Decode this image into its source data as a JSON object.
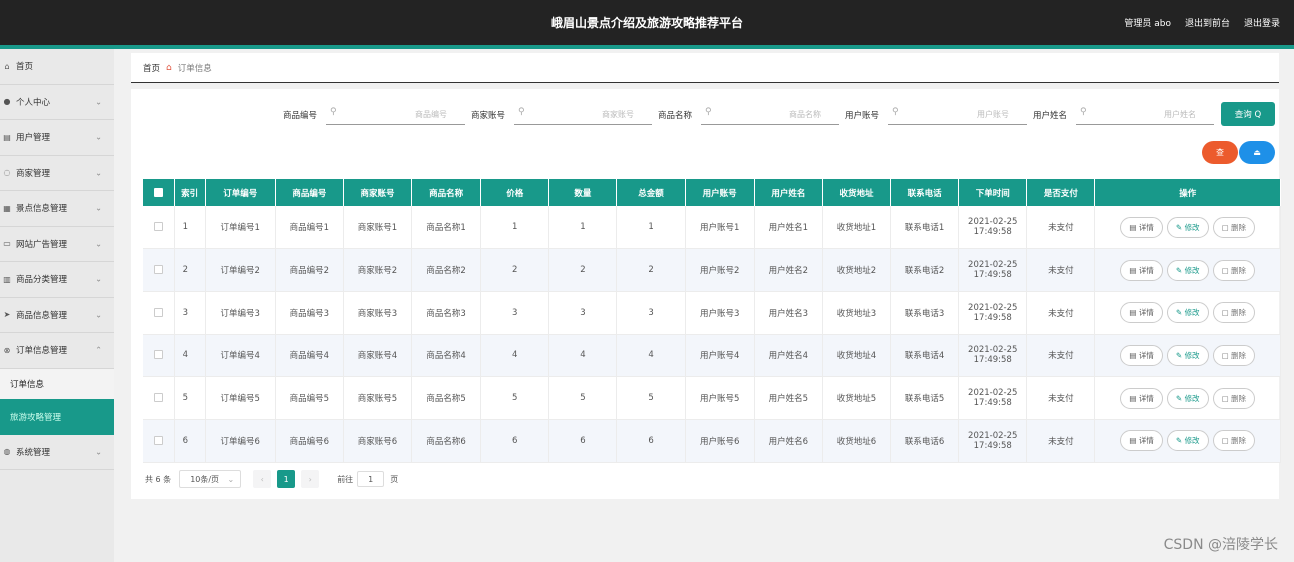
{
  "header": {
    "title": "峨眉山景点介绍及旅游攻略推荐平台",
    "admin_label": "管理员 abo",
    "exit_to_front": "退出到前台",
    "logout": "退出登录"
  },
  "sidebar": {
    "items": [
      {
        "label": "首页",
        "icon": "home-icon"
      },
      {
        "label": "个人中心",
        "icon": "user-icon"
      },
      {
        "label": "用户管理",
        "icon": "users-icon"
      },
      {
        "label": "商家管理",
        "icon": "store-icon"
      },
      {
        "label": "景点信息管理",
        "icon": "grid-icon"
      },
      {
        "label": "网站广告管理",
        "icon": "ad-icon"
      },
      {
        "label": "商品分类管理",
        "icon": "chart-icon"
      },
      {
        "label": "商品信息管理",
        "icon": "send-icon"
      },
      {
        "label": "订单信息管理",
        "icon": "order-icon"
      },
      {
        "label": "系统管理",
        "icon": "settings-icon"
      }
    ],
    "sub_order": "订单信息",
    "sub_active": "旅游攻略管理"
  },
  "breadcrumb": {
    "home": "首页",
    "current": "订单信息"
  },
  "search": {
    "fields": [
      {
        "label": "商品编号",
        "placeholder": "商品编号"
      },
      {
        "label": "商家账号",
        "placeholder": "商家账号"
      },
      {
        "label": "商品名称",
        "placeholder": "商品名称"
      },
      {
        "label": "用户账号",
        "placeholder": "用户账号"
      },
      {
        "label": "用户姓名",
        "placeholder": "用户姓名"
      }
    ],
    "button": "查询 Q"
  },
  "action_buttons": {
    "red": "查",
    "blue": "⏏"
  },
  "table": {
    "headers": [
      "",
      "索引",
      "订单编号",
      "商品编号",
      "商家账号",
      "商品名称",
      "价格",
      "数量",
      "总金额",
      "用户账号",
      "用户姓名",
      "收货地址",
      "联系电话",
      "下单时间",
      "是否支付",
      "操作"
    ],
    "ops": {
      "detail": "详情",
      "edit": "修改",
      "delete": "删除"
    },
    "rows": [
      [
        "1",
        "订单编号1",
        "商品编号1",
        "商家账号1",
        "商品名称1",
        "1",
        "1",
        "1",
        "用户账号1",
        "用户姓名1",
        "收货地址1",
        "联系电话1",
        "2021-02-25 17:49:58",
        "未支付"
      ],
      [
        "2",
        "订单编号2",
        "商品编号2",
        "商家账号2",
        "商品名称2",
        "2",
        "2",
        "2",
        "用户账号2",
        "用户姓名2",
        "收货地址2",
        "联系电话2",
        "2021-02-25 17:49:58",
        "未支付"
      ],
      [
        "3",
        "订单编号3",
        "商品编号3",
        "商家账号3",
        "商品名称3",
        "3",
        "3",
        "3",
        "用户账号3",
        "用户姓名3",
        "收货地址3",
        "联系电话3",
        "2021-02-25 17:49:58",
        "未支付"
      ],
      [
        "4",
        "订单编号4",
        "商品编号4",
        "商家账号4",
        "商品名称4",
        "4",
        "4",
        "4",
        "用户账号4",
        "用户姓名4",
        "收货地址4",
        "联系电话4",
        "2021-02-25 17:49:58",
        "未支付"
      ],
      [
        "5",
        "订单编号5",
        "商品编号5",
        "商家账号5",
        "商品名称5",
        "5",
        "5",
        "5",
        "用户账号5",
        "用户姓名5",
        "收货地址5",
        "联系电话5",
        "2021-02-25 17:49:58",
        "未支付"
      ],
      [
        "6",
        "订单编号6",
        "商品编号6",
        "商家账号6",
        "商品名称6",
        "6",
        "6",
        "6",
        "用户账号6",
        "用户姓名6",
        "收货地址6",
        "联系电话6",
        "2021-02-25 17:49:58",
        "未支付"
      ]
    ]
  },
  "pager": {
    "total": "共 6 条",
    "page_size": "10条/页",
    "current_page": "1",
    "goto_prefix": "前往",
    "goto_value": "1",
    "goto_suffix": "页"
  },
  "watermark": "CSDN @涪陵学长",
  "colors": {
    "accent": "#18998a",
    "header": "#232323",
    "red": "#ec5b2d",
    "blue": "#1e90e8"
  }
}
